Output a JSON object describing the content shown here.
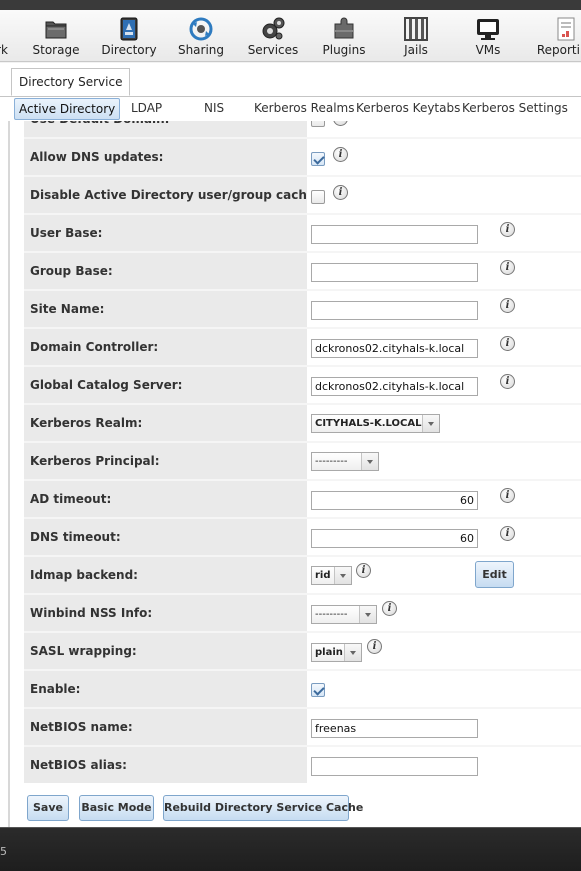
{
  "toolbar": {
    "items": [
      {
        "label": "rk",
        "icon": "network-icon"
      },
      {
        "label": "Storage",
        "icon": "storage-icon"
      },
      {
        "label": "Directory",
        "icon": "directory-icon"
      },
      {
        "label": "Sharing",
        "icon": "sharing-icon"
      },
      {
        "label": "Services",
        "icon": "services-icon"
      },
      {
        "label": "Plugins",
        "icon": "plugins-icon"
      },
      {
        "label": "Jails",
        "icon": "jails-icon"
      },
      {
        "label": "VMs",
        "icon": "vms-icon"
      },
      {
        "label": "Reporting",
        "icon": "reporting-icon"
      }
    ]
  },
  "main_tab": "Directory Service",
  "subtabs": [
    "Active Directory",
    "LDAP",
    "NIS",
    "Kerberos Realms",
    "Kerberos Keytabs",
    "Kerberos Settings"
  ],
  "form": {
    "use_default_domain": {
      "label": "Use Default Domain:",
      "checked": false
    },
    "allow_dns_updates": {
      "label": "Allow DNS updates:",
      "checked": true
    },
    "disable_cache": {
      "label": "Disable Active Directory user/group cache:",
      "checked": false
    },
    "user_base": {
      "label": "User Base:",
      "value": ""
    },
    "group_base": {
      "label": "Group Base:",
      "value": ""
    },
    "site_name": {
      "label": "Site Name:",
      "value": ""
    },
    "domain_controller": {
      "label": "Domain Controller:",
      "value": "dckronos02.cityhals-k.local"
    },
    "global_catalog": {
      "label": "Global Catalog Server:",
      "value": "dckronos02.cityhals-k.local"
    },
    "kerberos_realm": {
      "label": "Kerberos Realm:",
      "value": "CITYHALS-K.LOCAL"
    },
    "kerberos_principal": {
      "label": "Kerberos Principal:",
      "value": "---------"
    },
    "ad_timeout": {
      "label": "AD timeout:",
      "value": "60"
    },
    "dns_timeout": {
      "label": "DNS timeout:",
      "value": "60"
    },
    "idmap_backend": {
      "label": "Idmap backend:",
      "value": "rid",
      "edit_label": "Edit"
    },
    "winbind_nss": {
      "label": "Winbind NSS Info:",
      "value": "---------"
    },
    "sasl_wrapping": {
      "label": "SASL wrapping:",
      "value": "plain"
    },
    "enable": {
      "label": "Enable:",
      "checked": true
    },
    "netbios_name": {
      "label": "NetBIOS name:",
      "value": "freenas"
    },
    "netbios_alias": {
      "label": "NetBIOS alias:",
      "value": ""
    }
  },
  "buttons": {
    "save": "Save",
    "basic_mode": "Basic Mode",
    "rebuild_cache": "Rebuild Directory Service Cache"
  },
  "info_glyph": "i",
  "footer_fragment": "5"
}
